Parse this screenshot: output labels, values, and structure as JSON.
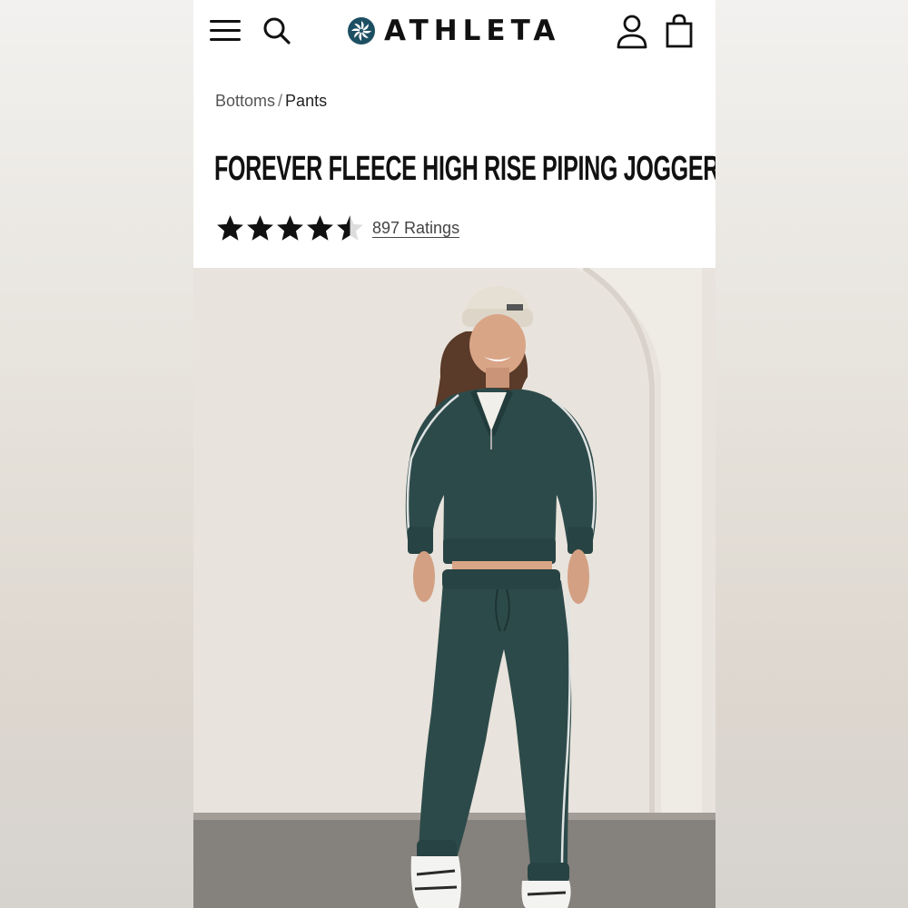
{
  "header": {
    "brand": "ATHLETA",
    "menu_icon": "hamburger-menu-icon",
    "search_icon": "search-icon",
    "account_icon": "user-account-icon",
    "bag_icon": "shopping-bag-icon",
    "brand_color": "#1d4f63"
  },
  "breadcrumb": {
    "parent": "Bottoms",
    "separator": "/",
    "current": "Pants"
  },
  "product": {
    "title": "FOREVER FLEECE HIGH RISE PIPING JOGGER",
    "rating": 4.5,
    "ratings_label": "897 Ratings",
    "image_colors": {
      "background": "#e8e3dc",
      "floor": "#7f7b76",
      "garment": "#2d4a4a",
      "beanie": "#e6e0d4"
    }
  }
}
